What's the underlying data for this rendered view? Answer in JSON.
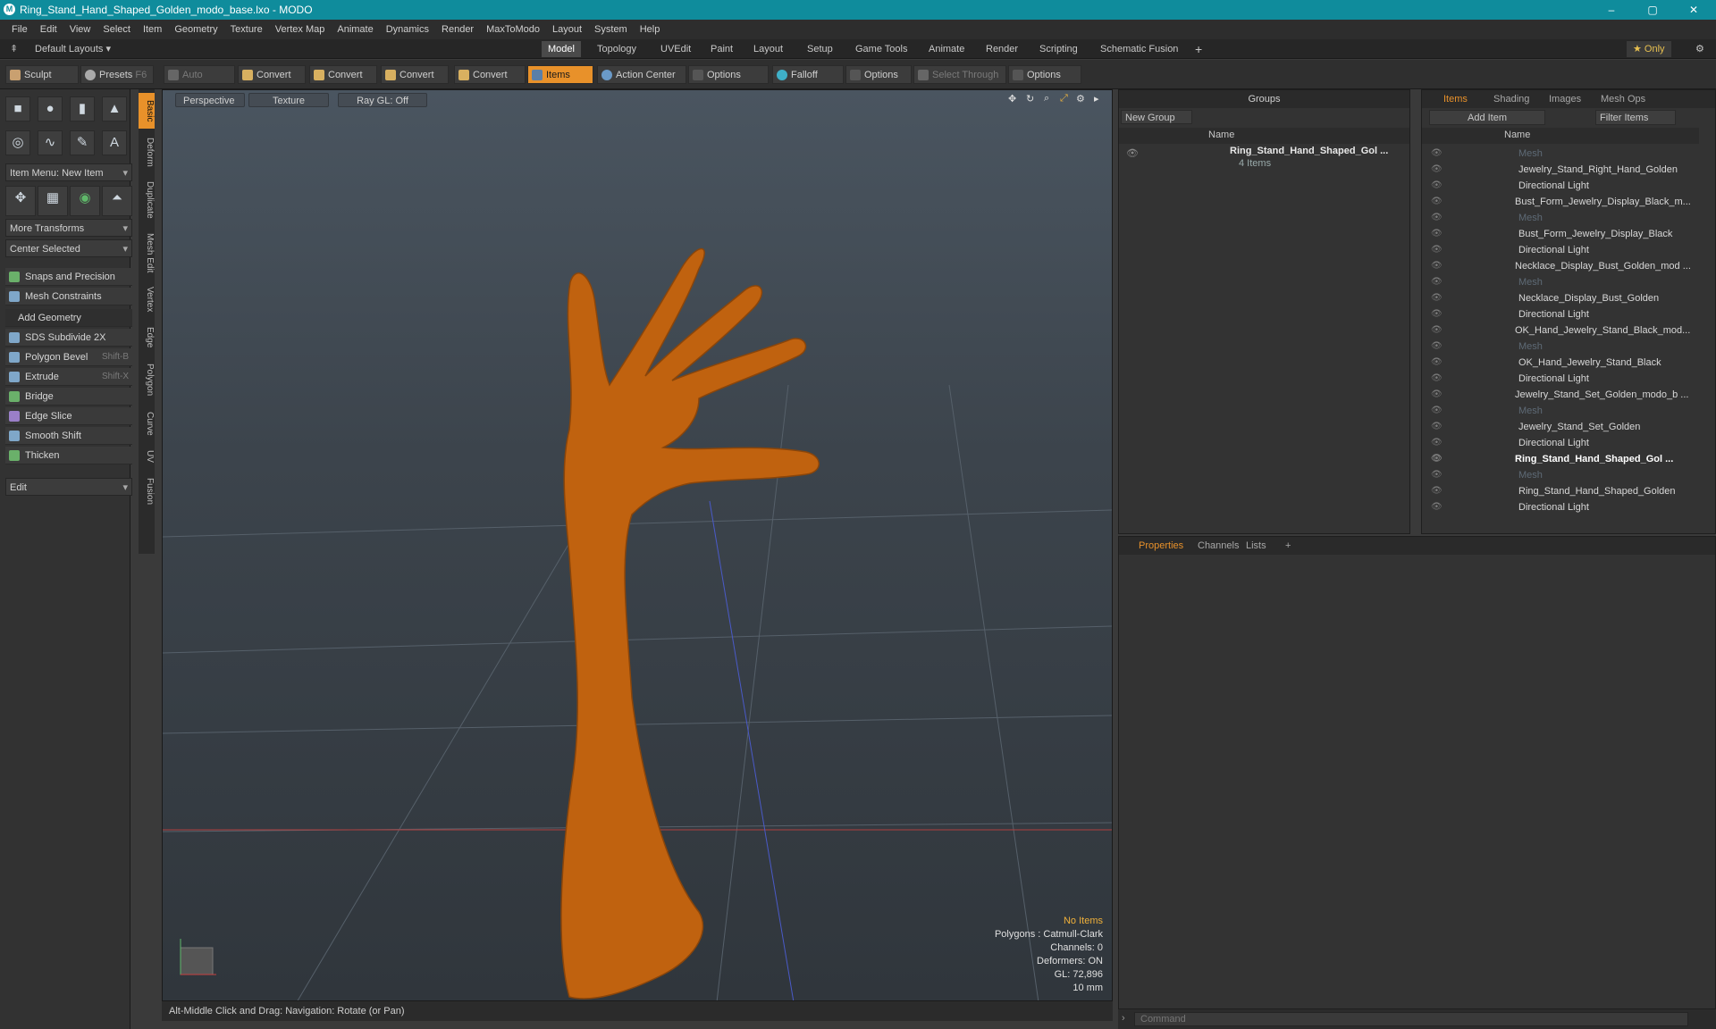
{
  "window": {
    "title": "Ring_Stand_Hand_Shaped_Golden_modo_base.lxo - MODO",
    "controls": [
      "–",
      "▢",
      "✕"
    ]
  },
  "menu": [
    "File",
    "Edit",
    "View",
    "Select",
    "Item",
    "Geometry",
    "Texture",
    "Vertex Map",
    "Animate",
    "Dynamics",
    "Render",
    "MaxToModo",
    "Layout",
    "System",
    "Help"
  ],
  "layoutbar": {
    "default_layouts": "Default Layouts ▾",
    "tabs": [
      "Model",
      "Topology",
      "UVEdit",
      "Paint",
      "Layout",
      "Setup",
      "Game Tools",
      "Animate",
      "Render",
      "Scripting",
      "Schematic Fusion"
    ],
    "active": "Model",
    "plus": "+",
    "only": "★ Only"
  },
  "toolbar": {
    "sculpt": "Sculpt",
    "presets": "Presets",
    "presets_key": "F6",
    "auto_select": "Auto Select",
    "convert1": "Convert",
    "convert2": "Convert",
    "convert3": "Convert",
    "convert4": "Convert",
    "items": "Items",
    "action_center": "Action Center",
    "options1": "Options",
    "falloff": "Falloff",
    "options2": "Options",
    "select_through": "Select Through",
    "options3": "Options"
  },
  "left": {
    "item_menu": "Item Menu: New Item",
    "more_transforms": "More Transforms",
    "center_selected": "Center Selected",
    "snaps": "Snaps and Precision",
    "mesh_constraints": "Mesh Constraints",
    "add_geometry": "Add Geometry",
    "tools": [
      {
        "label": "SDS Subdivide 2X",
        "key": ""
      },
      {
        "label": "Polygon Bevel",
        "key": "Shift-B"
      },
      {
        "label": "Extrude",
        "key": "Shift-X"
      },
      {
        "label": "Bridge",
        "key": ""
      },
      {
        "label": "Edge Slice",
        "key": ""
      },
      {
        "label": "Smooth Shift",
        "key": ""
      },
      {
        "label": "Thicken",
        "key": ""
      }
    ],
    "edit": "Edit"
  },
  "sidetabs": [
    "Basic",
    "Deform",
    "Duplicate",
    "Mesh Edit",
    "Vertex",
    "Edge",
    "Polygon",
    "Curve",
    "UV",
    "Fusion"
  ],
  "viewport": {
    "perspective": "Perspective",
    "texture": "Texture",
    "raygl": "Ray GL: Off",
    "hud": {
      "no_items": "No Items",
      "polygons": "Polygons : Catmull-Clark",
      "channels": "Channels: 0",
      "deformers": "Deformers: ON",
      "gl": "GL: 72,896",
      "scale": "10 mm"
    }
  },
  "status": "Alt-Middle Click and Drag:   Navigation: Rotate (or Pan)",
  "groups": {
    "title": "Groups",
    "new_group": "New Group",
    "col_name": "Name",
    "item": "Ring_Stand_Hand_Shaped_Gol ...",
    "count": "4 Items"
  },
  "items_panel": {
    "tabs": [
      "Items",
      "Shading",
      "Images",
      "Mesh Ops"
    ],
    "add_item": "Add Item",
    "filter": "Filter Items",
    "col_name": "Name",
    "rows": [
      {
        "label": "Mesh",
        "indent": 2,
        "style": "dim"
      },
      {
        "label": "Jewelry_Stand_Right_Hand_Golden",
        "indent": 2,
        "style": ""
      },
      {
        "label": "Directional Light",
        "indent": 2,
        "style": ""
      },
      {
        "label": "Bust_Form_Jewelry_Display_Black_m...",
        "indent": 1,
        "style": ""
      },
      {
        "label": "Mesh",
        "indent": 2,
        "style": "dim"
      },
      {
        "label": "Bust_Form_Jewelry_Display_Black",
        "indent": 2,
        "style": ""
      },
      {
        "label": "Directional Light",
        "indent": 2,
        "style": ""
      },
      {
        "label": "Necklace_Display_Bust_Golden_mod ...",
        "indent": 1,
        "style": ""
      },
      {
        "label": "Mesh",
        "indent": 2,
        "style": "dim"
      },
      {
        "label": "Necklace_Display_Bust_Golden",
        "indent": 2,
        "style": ""
      },
      {
        "label": "Directional Light",
        "indent": 2,
        "style": ""
      },
      {
        "label": "OK_Hand_Jewelry_Stand_Black_mod...",
        "indent": 1,
        "style": ""
      },
      {
        "label": "Mesh",
        "indent": 2,
        "style": "dim"
      },
      {
        "label": "OK_Hand_Jewelry_Stand_Black",
        "indent": 2,
        "style": ""
      },
      {
        "label": "Directional Light",
        "indent": 2,
        "style": ""
      },
      {
        "label": "Jewelry_Stand_Set_Golden_modo_b ...",
        "indent": 1,
        "style": ""
      },
      {
        "label": "Mesh",
        "indent": 2,
        "style": "dim"
      },
      {
        "label": "Jewelry_Stand_Set_Golden",
        "indent": 2,
        "style": ""
      },
      {
        "label": "Directional Light",
        "indent": 2,
        "style": ""
      },
      {
        "label": "Ring_Stand_Hand_Shaped_Gol ...",
        "indent": 1,
        "style": "bold"
      },
      {
        "label": "Mesh",
        "indent": 2,
        "style": "dim"
      },
      {
        "label": "Ring_Stand_Hand_Shaped_Golden",
        "indent": 2,
        "style": ""
      },
      {
        "label": "Directional Light",
        "indent": 2,
        "style": ""
      }
    ]
  },
  "props": {
    "tabs": [
      "Properties",
      "Channels",
      "Lists"
    ],
    "plus": "+"
  },
  "command": {
    "placeholder": "Command"
  }
}
